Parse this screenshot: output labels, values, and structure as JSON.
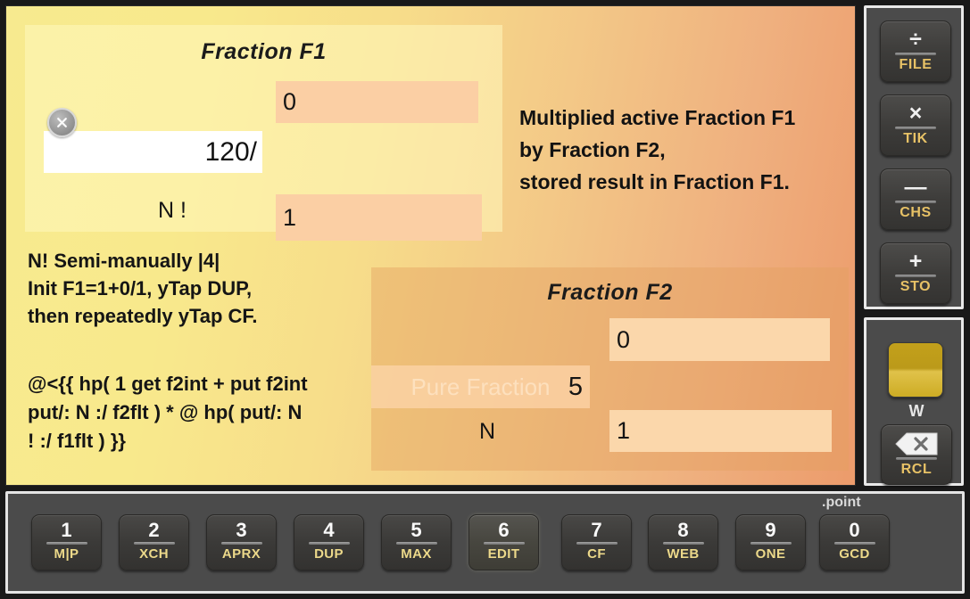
{
  "display": {
    "f1": {
      "title": "Fraction  F1",
      "clear_icon": "circle-x-icon",
      "numerator": "0",
      "integer_value": "120/",
      "denominator_label": "N !",
      "denominator": "1"
    },
    "f2": {
      "title": "Fraction  F2",
      "numerator": "0",
      "integer_value": "5",
      "integer_placeholder": "Pure Fraction",
      "denominator_label": "N",
      "denominator": "1"
    },
    "status_note": [
      "Multiplied active Fraction F1",
      "by Fraction F2,",
      "stored result in Fraction F1."
    ],
    "instructions": [
      "N! Semi-manually |4|",
      "Init F1=1+0/1, yTap DUP,",
      "then repeatedly yTap CF."
    ],
    "code_block": [
      "@<{{ hp( 1 get f2int + put f2int",
      "put/: N :/ f2flt ) * @ hp( put/: N",
      "! :/ f1flt ) }}"
    ]
  },
  "side_ops": {
    "keys": [
      {
        "glyph": "÷",
        "sub": "FILE",
        "icon": "divide-icon"
      },
      {
        "glyph": "×",
        "sub": "TIK",
        "icon": "multiply-icon"
      },
      {
        "glyph": "—",
        "sub": "CHS",
        "icon": "minus-icon"
      },
      {
        "glyph": "+",
        "sub": "STO",
        "icon": "plus-icon"
      }
    ]
  },
  "side_util": {
    "w_label": "W",
    "rcl_sub": "RCL",
    "rcl_icon": "backspace-icon"
  },
  "keypad": {
    "point_label": ".point",
    "keys": [
      {
        "digit": "1",
        "sub": "M|P",
        "active": false
      },
      {
        "digit": "2",
        "sub": "XCH",
        "active": false
      },
      {
        "digit": "3",
        "sub": "APRX",
        "active": false
      },
      {
        "digit": "4",
        "sub": "DUP",
        "active": false
      },
      {
        "digit": "5",
        "sub": "MAX",
        "active": false
      },
      {
        "digit": "6",
        "sub": "EDIT",
        "active": true
      },
      {
        "digit": "7",
        "sub": "CF",
        "active": false
      },
      {
        "digit": "8",
        "sub": "WEB",
        "active": false
      },
      {
        "digit": "9",
        "sub": "ONE",
        "active": false
      },
      {
        "digit": "0",
        "sub": "GCD",
        "active": false
      }
    ]
  },
  "colors": {
    "display_start": "#f7ea8f",
    "display_end": "#ec9b6b",
    "field_f1": "#fbcfa4",
    "field_f2": "#fbd7ab",
    "accent_gold": "#e8c266",
    "w_key": "#c3a01b",
    "panel_chrome": "#4b4b4b"
  }
}
